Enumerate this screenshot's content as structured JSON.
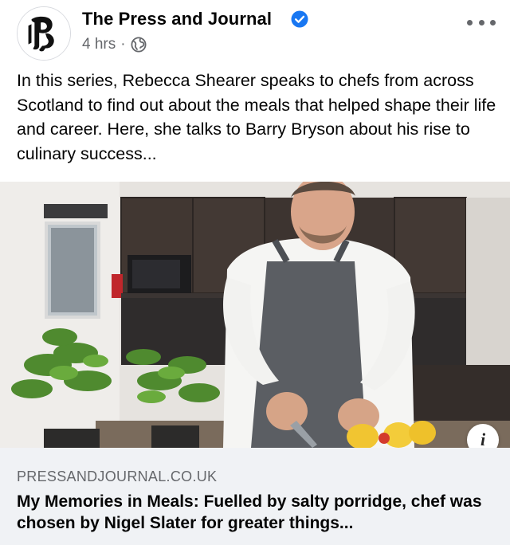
{
  "post": {
    "page_name": "The Press and Journal",
    "time": "4 hrs",
    "separator": "·",
    "text": "In this series, Rebecca Shearer speaks to chefs from across Scotland to find out about the meals that helped shape their life and career. Here, she talks to Barry Bryson about his rise to culinary success...",
    "icons": [
      "press-and-journal-logo",
      "verified-badge",
      "globe-icon",
      "more-options-icon"
    ]
  },
  "link_preview": {
    "domain": "PRESSANDJOURNAL.CO.UK",
    "headline": "My Memories in Meals: Fuelled by salty porridge, chef was chosen by Nigel Slater for greater things...",
    "info_icon": "info-icon"
  },
  "colors": {
    "verified": "#1877f2",
    "secondary_text": "#65676b",
    "card_background": "#f0f2f5"
  }
}
